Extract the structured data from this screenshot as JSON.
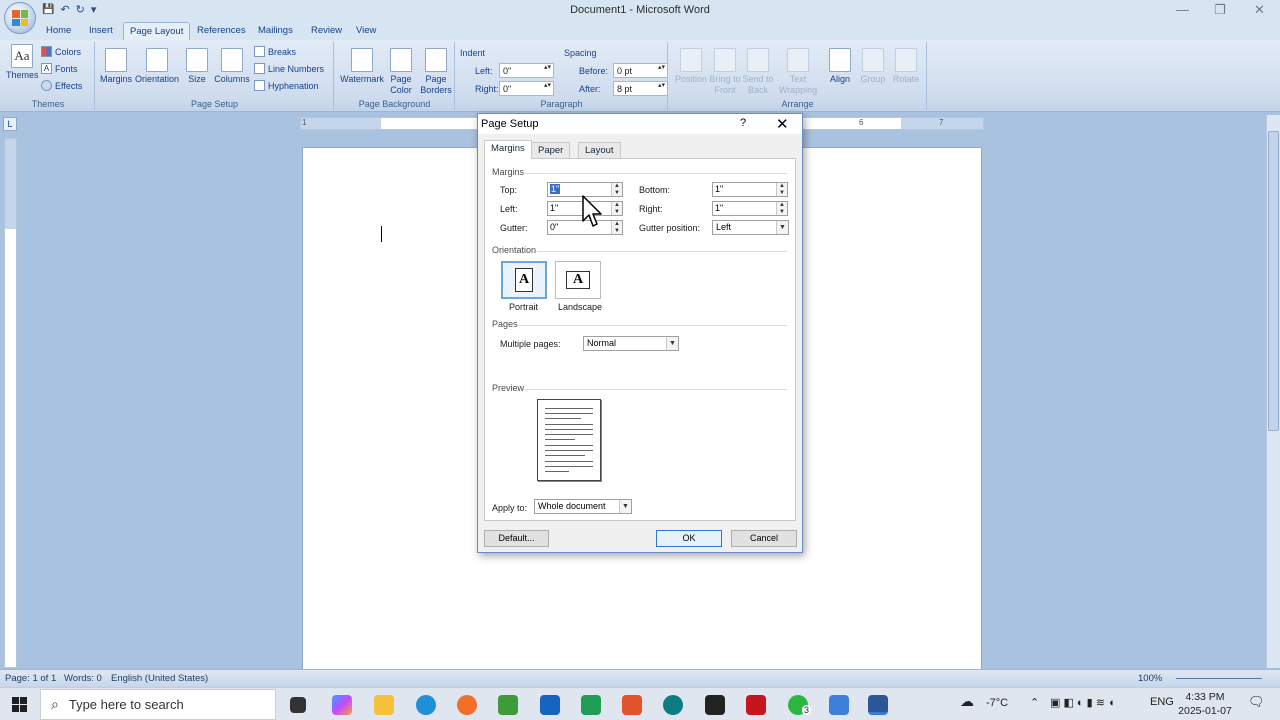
{
  "window": {
    "title": "Document1 - Microsoft Word",
    "minimize": "—",
    "restore": "❐",
    "close": "✕"
  },
  "qat": {
    "save": "💾",
    "undo": "↶",
    "redo": "↻",
    "more": "▾"
  },
  "tabs": [
    "Home",
    "Insert",
    "Page Layout",
    "References",
    "Mailings",
    "Review",
    "View"
  ],
  "ribbon": {
    "themes": {
      "themes": "Themes",
      "colors": "Colors",
      "fonts": "Fonts",
      "effects": "Effects",
      "group": "Themes"
    },
    "page_setup": {
      "margins": "Margins",
      "orientation": "Orientation",
      "size": "Size",
      "columns": "Columns",
      "breaks": "Breaks",
      "line_numbers": "Line Numbers",
      "hyphenation": "Hyphenation",
      "group": "Page Setup"
    },
    "page_background": {
      "watermark": "Watermark",
      "page_color": "Page Color",
      "page_borders": "Page Borders",
      "group": "Page Background"
    },
    "paragraph": {
      "indent": "Indent",
      "left_label": "Left:",
      "left_value": "0\"",
      "right_label": "Right:",
      "right_value": "0\"",
      "spacing": "Spacing",
      "before_label": "Before:",
      "before_value": "0 pt",
      "after_label": "After:",
      "after_value": "8 pt",
      "group": "Paragraph"
    },
    "arrange": {
      "position": "Position",
      "bring_to_front": "Bring to Front",
      "send_to_back": "Send to Back",
      "text_wrapping": "Text Wrapping",
      "align": "Align",
      "group_btn": "Group",
      "rotate": "Rotate",
      "group": "Arrange"
    }
  },
  "ruler": {
    "tab_selector": "L",
    "numbers": [
      "1",
      "6",
      "7"
    ]
  },
  "status": {
    "page": "Page: 1 of 1",
    "words": "Words: 0",
    "language": "English (United States)",
    "zoom": "100%"
  },
  "dialog": {
    "title": "Page Setup",
    "help": "?",
    "close": "✕",
    "tabs": [
      "Margins",
      "Paper",
      "Layout"
    ],
    "margins_section": "Margins",
    "top_label": "Top:",
    "top_value": "1\"",
    "bottom_label": "Bottom:",
    "bottom_value": "1\"",
    "left_label": "Left:",
    "left_value": "1\"",
    "right_label": "Right:",
    "right_value": "1\"",
    "gutter_label": "Gutter:",
    "gutter_value": "0\"",
    "gutter_pos_label": "Gutter position:",
    "gutter_pos_value": "Left",
    "orientation_section": "Orientation",
    "portrait": "Portrait",
    "landscape": "Landscape",
    "pages_section": "Pages",
    "multiple_pages_label": "Multiple pages:",
    "multiple_pages_value": "Normal",
    "preview_section": "Preview",
    "apply_to_label": "Apply to:",
    "apply_to_value": "Whole document",
    "default_btn": "Default...",
    "ok_btn": "OK",
    "cancel_btn": "Cancel"
  },
  "taskbar": {
    "search_placeholder": "Type here to search",
    "weather": "-7°C",
    "lang": "ENG",
    "time": "4:33 PM",
    "date": "2025-01-07",
    "badge": "3"
  }
}
